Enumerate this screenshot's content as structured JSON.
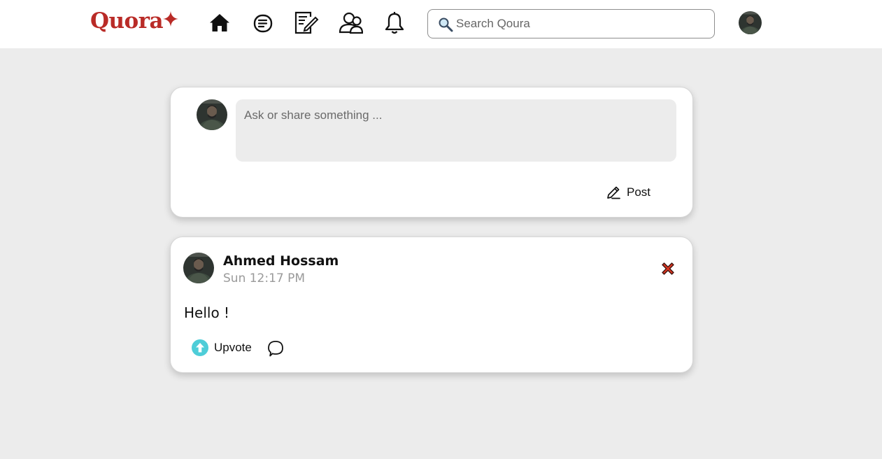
{
  "header": {
    "logo": "Quora",
    "search": {
      "placeholder": "Search Qoura",
      "value": ""
    },
    "nav": [
      "home-icon",
      "answer-icon",
      "write-icon",
      "spaces-icon",
      "notifications-icon"
    ]
  },
  "composer": {
    "placeholder": "Ask or share something ...",
    "post_label": "Post"
  },
  "post": {
    "author": "Ahmed Hossam",
    "time": "Sun 12:17 PM",
    "content": "Hello !",
    "upvote_label": "Upvote"
  },
  "colors": {
    "brand": "#b92b27",
    "page_bg": "#ececec",
    "upvote": "#4ecdd8",
    "delete": "#d9341f"
  }
}
